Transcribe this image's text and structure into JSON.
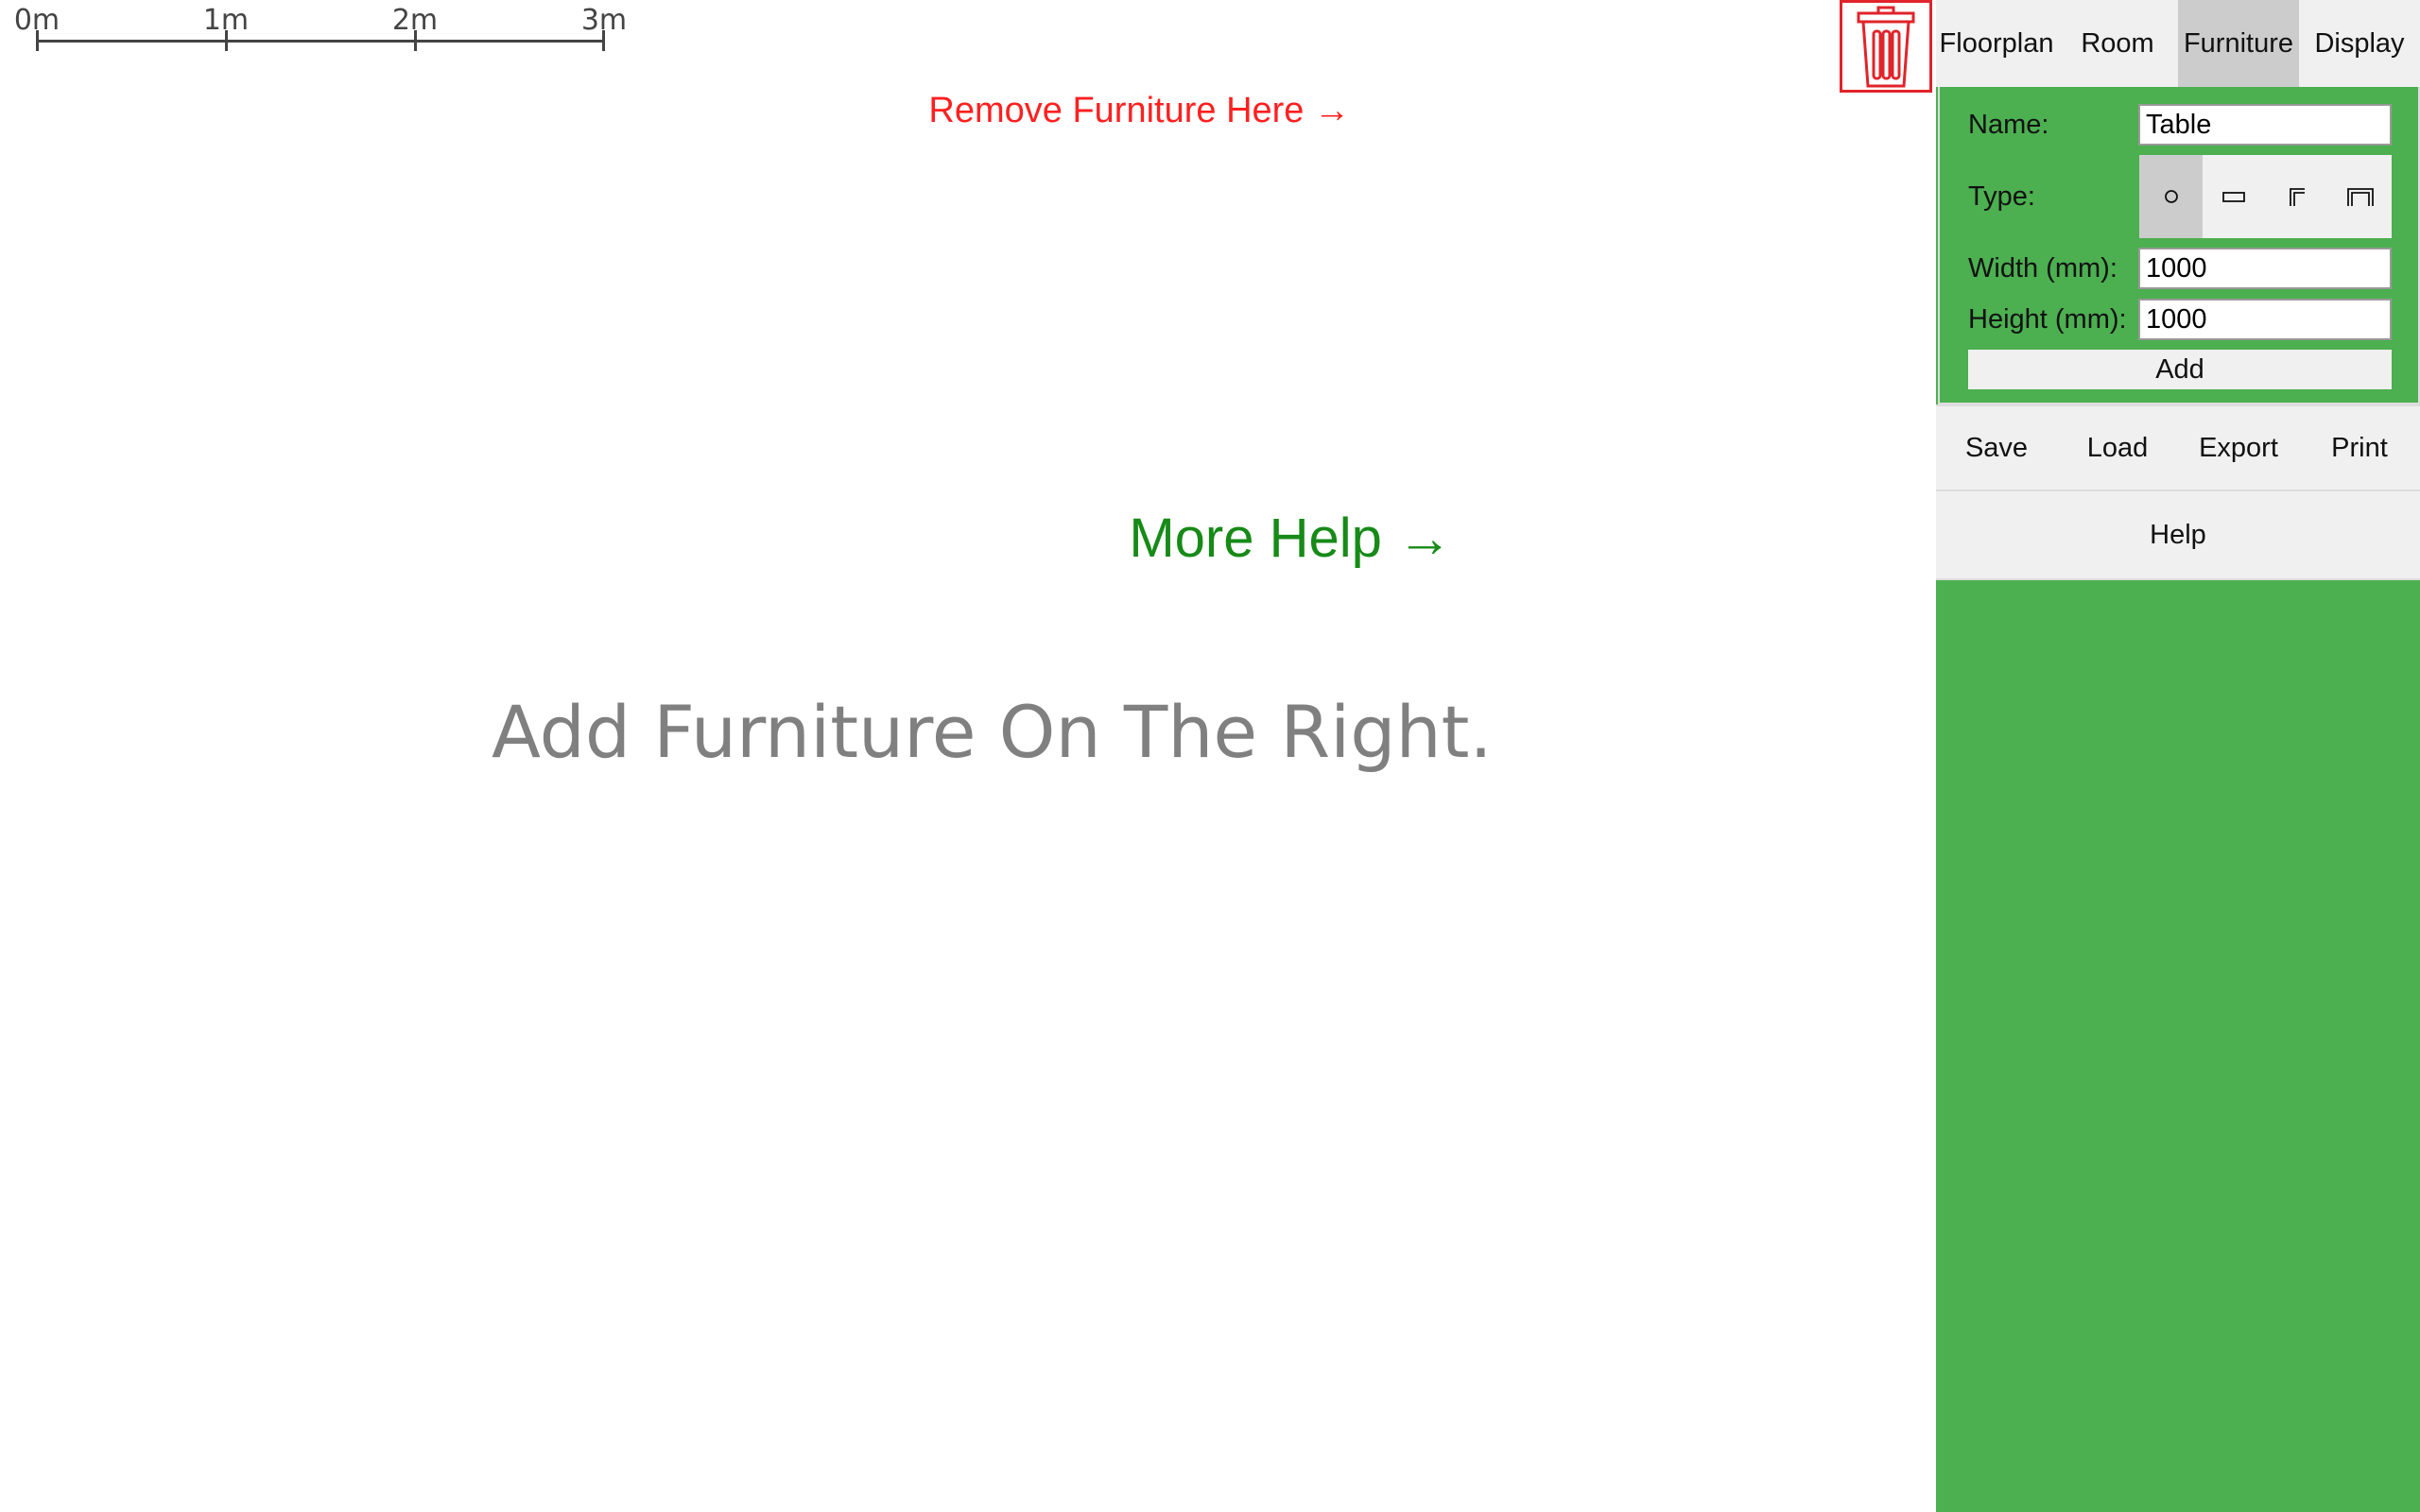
{
  "scale_bar": {
    "labels": [
      "0m",
      "1m",
      "2m",
      "3m"
    ]
  },
  "canvas": {
    "remove_hint": "Remove Furniture Here →",
    "more_help": "More Help →",
    "placeholder": "Add Furniture On The Right."
  },
  "tabs": [
    {
      "label": "Floorplan",
      "active": false
    },
    {
      "label": "Room",
      "active": false
    },
    {
      "label": "Furniture",
      "active": true
    },
    {
      "label": "Display",
      "active": false
    }
  ],
  "furniture_form": {
    "name_label": "Name:",
    "name_value": "Table",
    "type_label": "Type:",
    "types": [
      {
        "icon": "circle-icon",
        "glyph": "○",
        "active": true
      },
      {
        "icon": "rectangle-icon",
        "glyph": "▭",
        "active": false
      },
      {
        "icon": "corner-icon",
        "glyph": "╔",
        "active": false
      },
      {
        "icon": "u-shape-icon",
        "glyph": "╓",
        "active": false
      }
    ],
    "width_label": "Width (mm):",
    "width_value": "1000",
    "height_label": "Height (mm):",
    "height_value": "1000",
    "add_label": "Add"
  },
  "file_actions": [
    {
      "label": "Save"
    },
    {
      "label": "Load"
    },
    {
      "label": "Export"
    },
    {
      "label": "Print"
    }
  ],
  "help_label": "Help",
  "colors": {
    "panel_green": "#4caf50",
    "trash_red": "#e0242a",
    "hint_red": "#ff2020",
    "help_green": "#178a17",
    "placeholder_gray": "#808080"
  }
}
